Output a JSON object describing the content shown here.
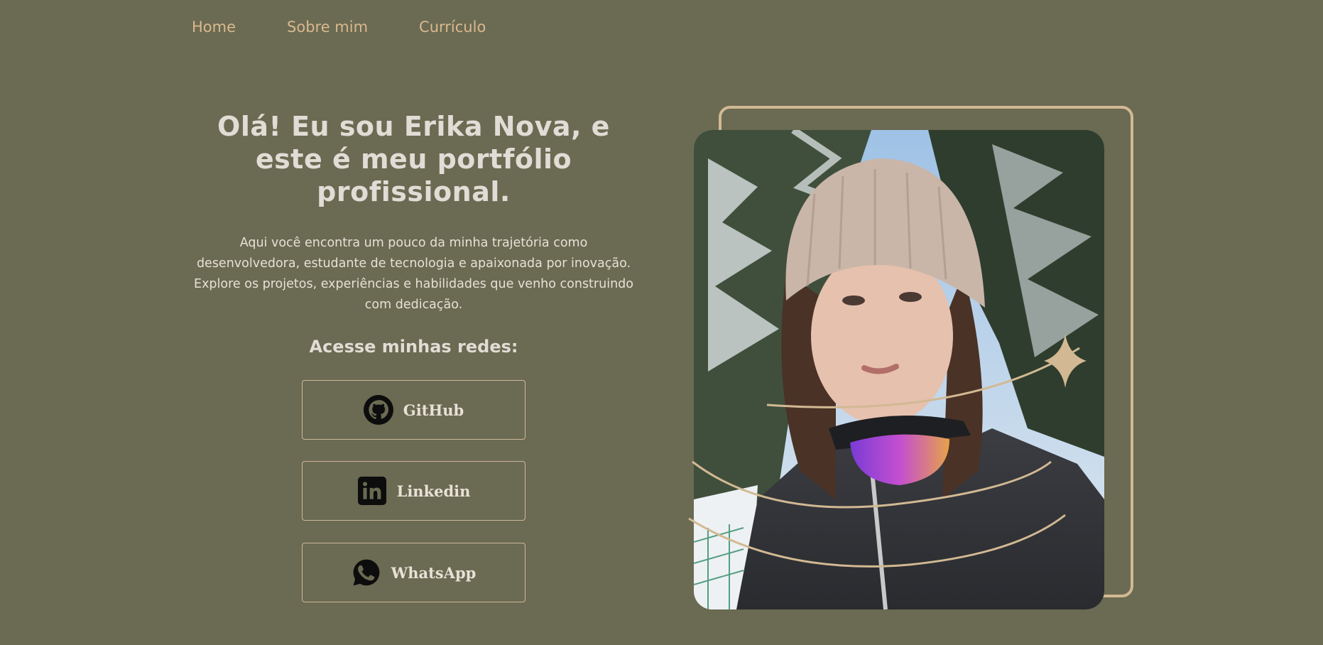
{
  "nav": {
    "items": [
      {
        "label": "Home"
      },
      {
        "label": "Sobre mim"
      },
      {
        "label": "Currículo"
      }
    ]
  },
  "hero": {
    "title": "Olá! Eu sou Erika Nova, e este é meu portfólio profissional.",
    "description": "Aqui você encontra um pouco da minha trajetória como desenvolvedora, estudante de tecnologia e apaixonada por inovação. Explore os projetos, experiências e habilidades que venho construindo com dedicação."
  },
  "social": {
    "heading": "Acesse minhas redes:",
    "buttons": [
      {
        "label": "GitHub",
        "icon": "github-icon"
      },
      {
        "label": "Linkedin",
        "icon": "linkedin-icon"
      },
      {
        "label": "WhatsApp",
        "icon": "whatsapp-icon"
      }
    ]
  },
  "colors": {
    "background": "#6b6a52",
    "accent": "#d9b98e",
    "text": "#e1dcd5",
    "frame": "#d2b993"
  }
}
